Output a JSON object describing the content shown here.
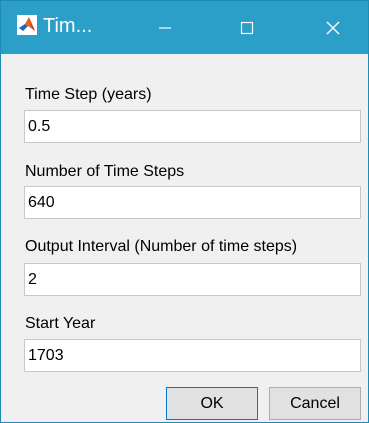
{
  "window": {
    "title": "Tim...",
    "titlebar_color": "#2b9fc7",
    "icons": {
      "app": "matlab-logo-icon",
      "minimize": "minimize-icon",
      "maximize": "maximize-icon",
      "close": "close-icon"
    }
  },
  "form": {
    "time_step": {
      "label": "Time Step (years)",
      "value": "0.5"
    },
    "num_steps": {
      "label": "Number of Time Steps",
      "value": "640"
    },
    "output_interval": {
      "label": "Output Interval (Number of time steps)",
      "value": "2"
    },
    "start_year": {
      "label": "Start Year",
      "value": "1703"
    }
  },
  "buttons": {
    "ok": "OK",
    "cancel": "Cancel"
  }
}
